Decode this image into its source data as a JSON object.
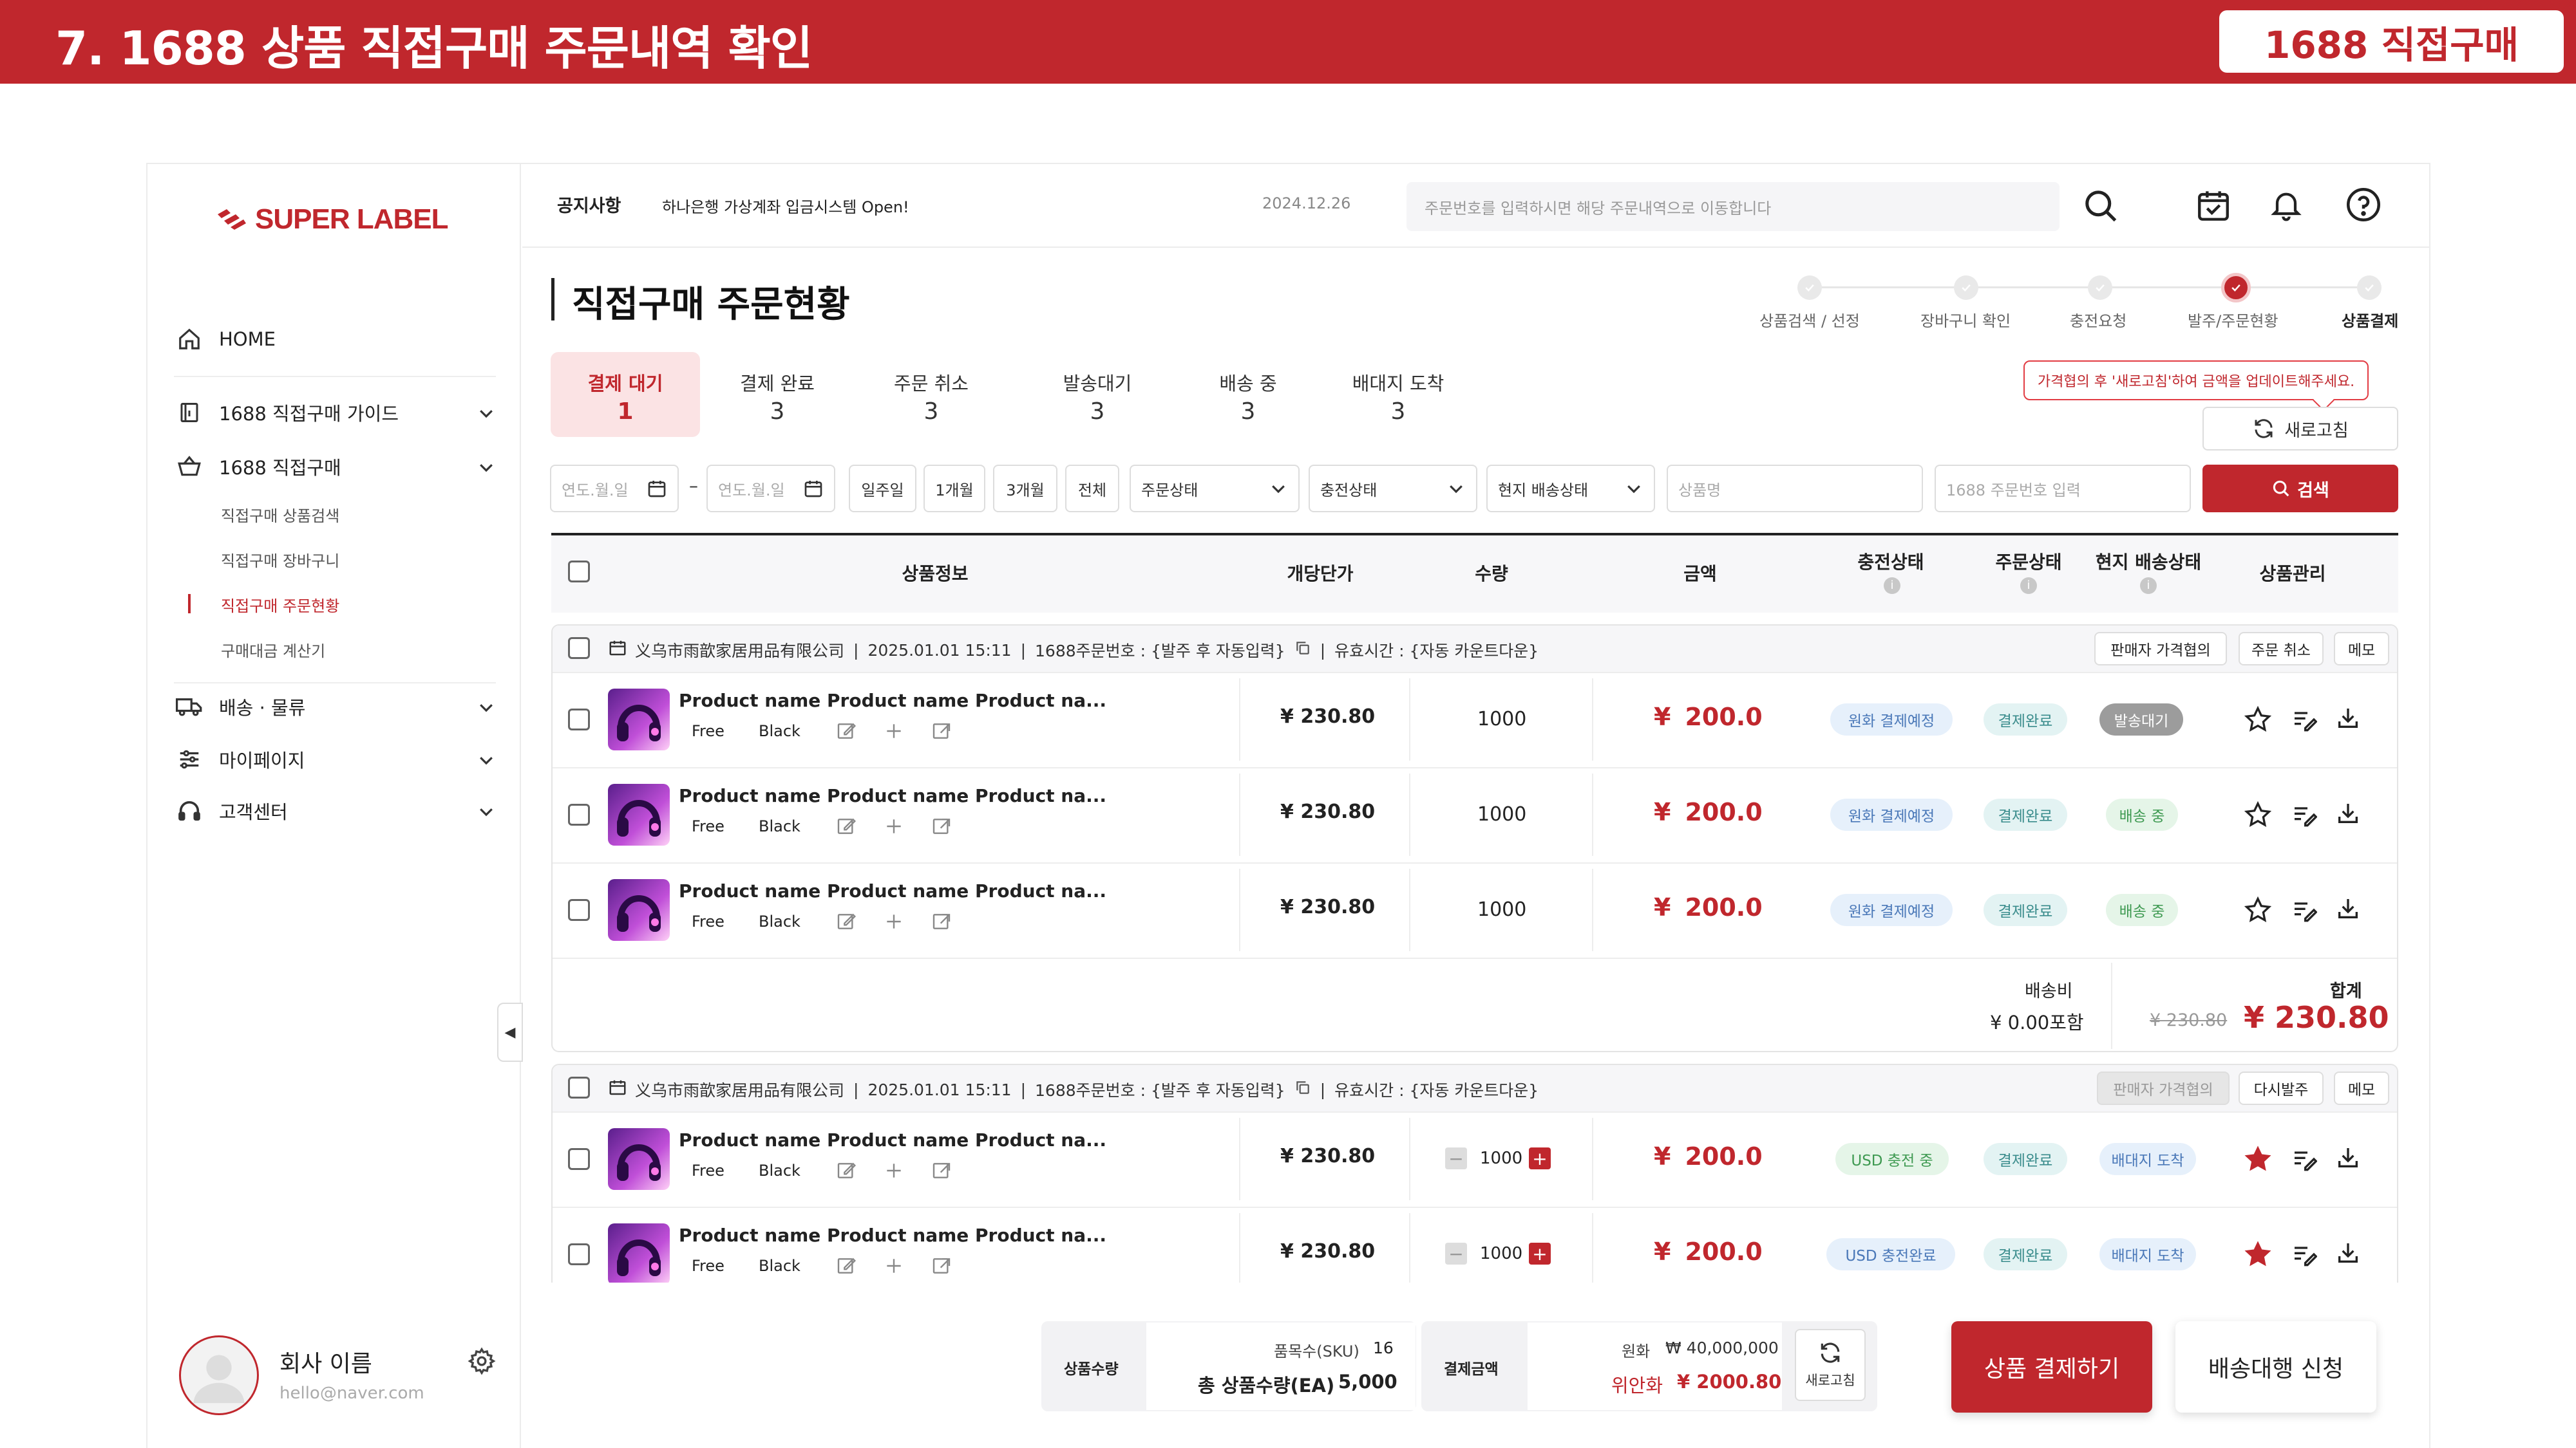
{
  "banner": {
    "title": "7. 1688 상품 직접구매 주문내역 확인",
    "badge": "1688 직접구매"
  },
  "sidebar": {
    "logo": "SUPER LABEL",
    "home": "HOME",
    "items": [
      {
        "label": "1688 직접구매 가이드",
        "icon": "book-icon"
      },
      {
        "label": "1688 직접구매",
        "icon": "basket-icon"
      },
      {
        "label": "배송 · 물류",
        "icon": "truck-icon"
      },
      {
        "label": "마이페이지",
        "icon": "sliders-icon"
      },
      {
        "label": "고객센터",
        "icon": "headset-icon"
      }
    ],
    "subitems": [
      "직접구매 상품검색",
      "직접구매 장바구니",
      "직접구매 주문현황",
      "구매대금 계산기"
    ],
    "company_name": "회사 이름",
    "email": "hello@naver.com"
  },
  "topbar": {
    "notice_label": "공지사항",
    "notice_text": "하나은행 가상계좌 입금시스템 Open!",
    "notice_date": "2024.12.26",
    "search_placeholder": "주문번호를 입력하시면 해당 주문내역으로 이동합니다"
  },
  "page": {
    "title": "직접구매 주문현황"
  },
  "steps": [
    "상품검색 / 선정",
    "장바구니 확인",
    "충전요청",
    "발주/주문현황",
    "상품결제"
  ],
  "tabs": [
    {
      "label": "결제 대기",
      "count": "1"
    },
    {
      "label": "결제 완료",
      "count": "3"
    },
    {
      "label": "주문 취소",
      "count": "3"
    },
    {
      "label": "발송대기",
      "count": "3"
    },
    {
      "label": "배송 중",
      "count": "3"
    },
    {
      "label": "배대지 도착",
      "count": "3"
    }
  ],
  "tooltip": "가격협의 후 '새로고침'하여 금액을 업데이트해주세요.",
  "refresh_label": "새로고침",
  "filters": {
    "date_placeholder": "연도.월.일",
    "date_sep": "–",
    "ranges": [
      "일주일",
      "1개월",
      "3개월",
      "전체"
    ],
    "selects": [
      "주문상태",
      "충전상태",
      "현지 배송상태"
    ],
    "product_placeholder": "상품명",
    "order_placeholder": "1688 주문번호 입력",
    "search_button": "검색"
  },
  "table_headers": [
    "상품정보",
    "개당단가",
    "수량",
    "금액",
    "충전상태",
    "주문상태",
    "현지 배송상태",
    "상품관리"
  ],
  "groups": [
    {
      "supplier": "义乌市雨歆家居用品有限公司",
      "datetime": "2025.01.01 15:11",
      "order_no": "1688주문번호 : {발주 후 자동입력}",
      "valid_time": "유효시간 : {자동 카운트다운}",
      "buttons": [
        "판매자 가격협의",
        "주문 취소",
        "메모"
      ],
      "rows": [
        {
          "name": "Product name Product name Product na...",
          "size": "Free",
          "color": "Black",
          "unit_price": "¥ 230.80",
          "qty": "1000",
          "amount": "200.0",
          "charge": "원화 결제예정",
          "order": "결제완료",
          "ship": "발송대기"
        },
        {
          "name": "Product name Product name Product na...",
          "size": "Free",
          "color": "Black",
          "unit_price": "¥ 230.80",
          "qty": "1000",
          "amount": "200.0",
          "charge": "원화 결제예정",
          "order": "결제완료",
          "ship": "배송 중"
        },
        {
          "name": "Product name Product name Product na...",
          "size": "Free",
          "color": "Black",
          "unit_price": "¥ 230.80",
          "qty": "1000",
          "amount": "200.0",
          "charge": "원화 결제예정",
          "order": "결제완료",
          "ship": "배송 중"
        }
      ],
      "shipping_label": "배송비",
      "shipping_value": "¥ 0.00포함",
      "total_label": "합계",
      "total_old": "¥ 230.80",
      "total_new": "¥ 230.80"
    },
    {
      "supplier": "义乌市雨歆家居用品有限公司",
      "datetime": "2025.01.01 15:11",
      "order_no": "1688주문번호 : {발주 후 자동입력}",
      "valid_time": "유효시간 : {자동 카운트다운}",
      "buttons": [
        "판매자 가격협의",
        "다시발주",
        "메모"
      ],
      "rows": [
        {
          "name": "Product name Product name Product na...",
          "size": "Free",
          "color": "Black",
          "unit_price": "¥ 230.80",
          "qty": "1000",
          "amount": "200.0",
          "charge": "USD 충전 중",
          "order": "결제완료",
          "ship": "배대지 도착"
        },
        {
          "name": "Product name Product name Product na...",
          "size": "Free",
          "color": "Black",
          "unit_price": "¥ 230.80",
          "qty": "1000",
          "amount": "200.0",
          "charge": "USD 충전완료",
          "order": "결제완료",
          "ship": "배대지 도착"
        }
      ]
    }
  ],
  "amount_currency": "¥",
  "bottom": {
    "qty_label": "상품수량",
    "sku_label": "품목수(SKU)",
    "sku_value": "16",
    "total_qty_label": "총 상품수량(EA)",
    "total_qty_value": "5,000",
    "pay_label": "결제금액",
    "krw_label": "원화",
    "krw_value": "₩ 40,000,000",
    "cny_label": "위안화",
    "cny_value": "¥ 2000.80",
    "refresh": "새로고침",
    "pay_button": "상품 결제하기",
    "ship_button": "배송대행 신청"
  },
  "colors": {
    "brand": "#c0272d"
  }
}
